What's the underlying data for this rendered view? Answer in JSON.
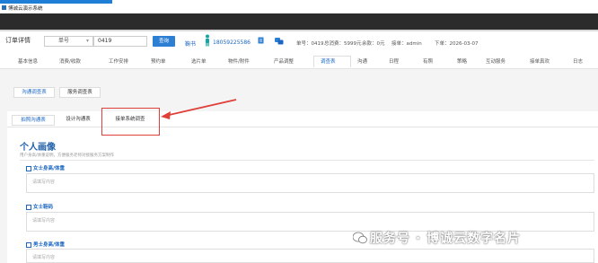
{
  "window": {
    "title": "博诚云演示系统"
  },
  "order_bar": {
    "label": "订单详情",
    "select_value": "单号",
    "input_value": "0419",
    "query_button": "查询",
    "link_text": "鞠书",
    "phone": "18059225586",
    "info": [
      "单号：0419",
      "总消费：5999元",
      "余款：0元",
      "接单：admin",
      "下单：2026-03-07"
    ],
    "balance_highlight_color": "#e0403a"
  },
  "main_tabs": [
    "基本信息",
    "消费/收款",
    "工作安排",
    "预约单",
    "选片单",
    "物件/附件",
    "产品调整",
    "调查表",
    "沟通",
    "日程",
    "有照",
    "策略",
    "互动服务",
    "接单真欢",
    "日志"
  ],
  "main_tab_active": "调查表",
  "sub_tabs": [
    "沟通调查表",
    "服务调查表"
  ],
  "sub_tab_active": "沟通调查表",
  "third_tabs": [
    "拍照沟通表",
    "设计沟通表",
    "接单系统调查"
  ],
  "third_tab_active": "拍照沟通表",
  "section": {
    "title": "个人画像",
    "subtitle": "用户身高/体重说明，方便服务老师对接服务方案制作"
  },
  "questions": [
    {
      "label": "女士身高/体重",
      "placeholder": "请填写内容"
    },
    {
      "label": "女士鞋码",
      "placeholder": "请填写内容"
    },
    {
      "label": "男士身高/体重",
      "placeholder": "请填写内容"
    }
  ],
  "watermark": "服务号 · 博诚云数字名片",
  "colors": {
    "accent": "#2d7fd3",
    "annotation": "#e0403a",
    "dark_band": "#2b2b2b"
  }
}
